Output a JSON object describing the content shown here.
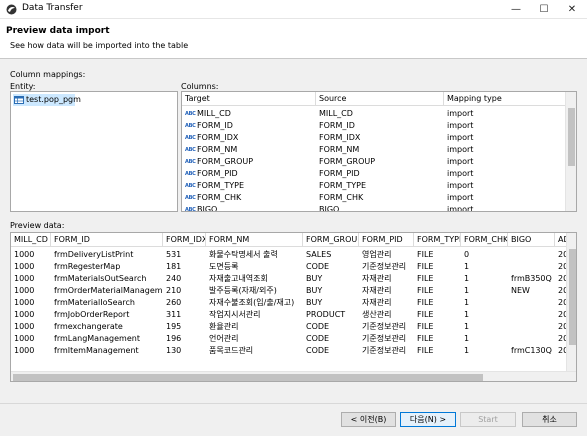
{
  "window": {
    "title": "Data Transfer",
    "minimize_glyph": "—",
    "maximize_glyph": "☐",
    "close_glyph": "✕"
  },
  "banner": {
    "title": "Preview data import",
    "description": "See how data will be imported into the table"
  },
  "mappings": {
    "section_label": "Column mappings:",
    "entity_label": "Entity:",
    "entity_item": "test.pop_pgm",
    "columns_label": "Columns:",
    "headers": [
      "Target",
      "Source",
      "Mapping type"
    ],
    "rows": [
      [
        "MILL_CD",
        "MILL_CD",
        "import"
      ],
      [
        "FORM_ID",
        "FORM_ID",
        "import"
      ],
      [
        "FORM_IDX",
        "FORM_IDX",
        "import"
      ],
      [
        "FORM_NM",
        "FORM_NM",
        "import"
      ],
      [
        "FORM_GROUP",
        "FORM_GROUP",
        "import"
      ],
      [
        "FORM_PID",
        "FORM_PID",
        "import"
      ],
      [
        "FORM_TYPE",
        "FORM_TYPE",
        "import"
      ],
      [
        "FORM_CHK",
        "FORM_CHK",
        "import"
      ],
      [
        "BIGO",
        "BIGO",
        "import"
      ]
    ]
  },
  "preview": {
    "label": "Preview data:",
    "headers": [
      "MILL_CD",
      "FORM_ID",
      "FORM_IDX",
      "FORM_NM",
      "FORM_GROUP",
      "FORM_PID",
      "FORM_TYPE",
      "FORM_CHK",
      "BIGO",
      "AD"
    ],
    "rows": [
      [
        "1000",
        "frmDeliveryListPrint",
        "531",
        "화물수탁명세서 출력",
        "SALES",
        "영업관리",
        "FILE",
        "0",
        "",
        "20"
      ],
      [
        "1000",
        "frmRegesterMap",
        "181",
        "도면등록",
        "CODE",
        "기준정보관리",
        "FILE",
        "1",
        "",
        "20"
      ],
      [
        "1000",
        "frmMaterialsOutSearch",
        "240",
        "자재출고내역조회",
        "BUY",
        "자재관리",
        "FILE",
        "1",
        "frmB350Q",
        "20"
      ],
      [
        "1000",
        "frmOrderMaterialManagement",
        "210",
        "발주등록(자재/외주)",
        "BUY",
        "자재관리",
        "FILE",
        "1",
        "NEW",
        "20"
      ],
      [
        "1000",
        "frmMaterialIoSearch",
        "260",
        "자재수불조회(입/출/재고)",
        "BUY",
        "자재관리",
        "FILE",
        "1",
        "",
        "20"
      ],
      [
        "1000",
        "frmJobOrderReport",
        "311",
        "작업지시서관리",
        "PRODUCT",
        "생산관리",
        "FILE",
        "1",
        "",
        "20"
      ],
      [
        "1000",
        "frmexchangerate",
        "195",
        "환율관리",
        "CODE",
        "기준정보관리",
        "FILE",
        "1",
        "",
        "20"
      ],
      [
        "1000",
        "frmLangManagement",
        "196",
        "언어관리",
        "CODE",
        "기준정보관리",
        "FILE",
        "1",
        "",
        "20"
      ],
      [
        "1000",
        "frmItemManagement",
        "130",
        "품목코드관리",
        "CODE",
        "기준정보관리",
        "FILE",
        "1",
        "frmC130Q",
        "20"
      ]
    ]
  },
  "buttons": {
    "back": "< 이전(B)",
    "next": "다음(N) >",
    "start": "Start",
    "cancel": "취소"
  },
  "icons": {
    "column_type": "ABC",
    "table": "table-icon"
  },
  "colors": {
    "accent": "#0078d7",
    "selection": "#cce8ff"
  }
}
